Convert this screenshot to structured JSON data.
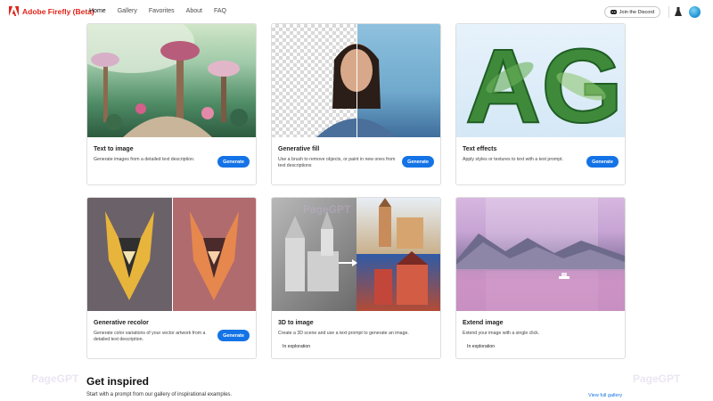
{
  "header": {
    "brand": "Adobe Firefly (Beta)",
    "nav": [
      "Home",
      "Gallery",
      "Favorites",
      "About",
      "FAQ"
    ],
    "discord_label": "Join the Discord",
    "brand_color": "#e1251b"
  },
  "cards": [
    {
      "title": "Text to image",
      "desc": "Generate images from a detailed text description.",
      "button": "Generate"
    },
    {
      "title": "Generative fill",
      "desc": "Use a brush to remove objects, or paint in new ones from text descriptions",
      "button": "Generate"
    },
    {
      "title": "Text effects",
      "desc": "Apply styles or textures to text with a text prompt.",
      "button": "Generate"
    },
    {
      "title": "Generative recolor",
      "desc": "Generate color variations of your vector artwork from a detailed text description.",
      "button": "Generate"
    },
    {
      "title": "3D to image",
      "desc": "Create a 3D scene and use a text prompt to generate an image.",
      "badge": "In exploration"
    },
    {
      "title": "Extend image",
      "desc": "Extend your image with a single click.",
      "badge": "In exploration"
    }
  ],
  "inspired": {
    "title": "Get inspired",
    "subtitle": "Start with a prompt from our gallery of inspirational examples.",
    "link": "View full gallery"
  },
  "text_effects_letters": "AG",
  "watermark": "PageGPT",
  "accent_color": "#1473e6"
}
